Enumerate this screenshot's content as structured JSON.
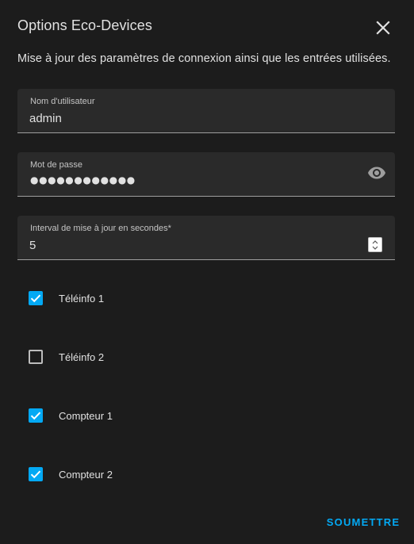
{
  "dialog": {
    "title": "Options Eco-Devices",
    "description": "Mise à jour des paramètres de connexion ainsi que les entrées utilisées."
  },
  "fields": {
    "username": {
      "label": "Nom d'utilisateur",
      "value": "admin"
    },
    "password": {
      "label": "Mot de passe",
      "masked_value": "●●●●●●●●●●●●"
    },
    "interval": {
      "label": "Interval de mise à jour en secondes*",
      "value": "5"
    }
  },
  "checkboxes": [
    {
      "label": "Téléinfo 1",
      "checked": true
    },
    {
      "label": "Téléinfo 2",
      "checked": false
    },
    {
      "label": "Compteur 1",
      "checked": true
    },
    {
      "label": "Compteur 2",
      "checked": true
    }
  ],
  "actions": {
    "submit_label": "SOUMETTRE"
  },
  "colors": {
    "background": "#1c1c1c",
    "field_background": "#2a2a2a",
    "accent": "#03a9f4",
    "text": "#e1e1e1"
  },
  "icons": {
    "close": "close-icon",
    "visibility": "eye-icon",
    "check": "check-icon"
  }
}
